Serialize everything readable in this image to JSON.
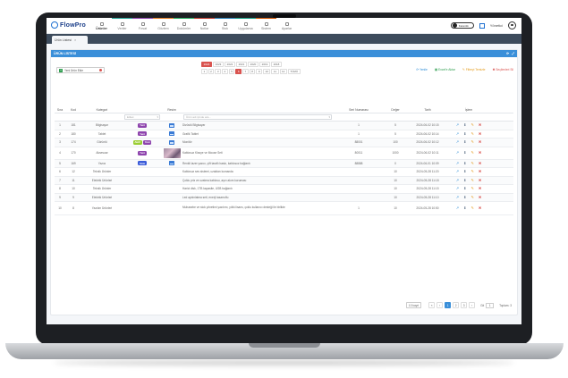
{
  "app": {
    "logo_text": "FlowPro"
  },
  "nav": [
    {
      "label": "Ürünler"
    },
    {
      "label": "Veriler"
    },
    {
      "label": "Fırsat"
    },
    {
      "label": "Gözlem"
    },
    {
      "label": "Dokümler"
    },
    {
      "label": "Notlar"
    },
    {
      "label": "Stok"
    },
    {
      "label": "Uygulama"
    },
    {
      "label": "Sistem"
    },
    {
      "label": "Ayarlar"
    }
  ],
  "topbar": {
    "toggle_label": "Karanlık",
    "username": "Yönetici"
  },
  "tab": {
    "label": "Ürün Listesi"
  },
  "card": {
    "title": "ÜRÜN LİSTESİ"
  },
  "toolbar": {
    "add_label": "Yeni Ürün Ekle",
    "years": [
      "2024",
      "2023",
      "2022",
      "2021",
      "2020",
      "2019",
      "2018"
    ],
    "active_year": "2024",
    "months": [
      "1",
      "2",
      "3",
      "4",
      "5",
      "6",
      "7",
      "8",
      "9",
      "10",
      "11",
      "12",
      "TÜMÜ"
    ],
    "active_month": "6",
    "actions": [
      {
        "label": "Yenile"
      },
      {
        "label": "Excel'e Aktar"
      },
      {
        "label": "Filtreyi Temizle"
      },
      {
        "label": "Seçilenleri Sil"
      }
    ]
  },
  "table": {
    "headers": {
      "sira": "Sıra",
      "kod": "Kod",
      "kategori": "Kategori",
      "etiket": "",
      "resim": "Resim",
      "ad": "",
      "seri": "Seri Numarası",
      "deger": "Değer",
      "tarih": "Tarih",
      "islem": "İşlem"
    },
    "filters": {
      "etiket": "Etiket",
      "ad": "Ürün adı içinde ara..."
    },
    "rows": [
      {
        "sira": "1",
        "kod": "181",
        "kategori": "Bilgisayar",
        "tags": [
          {
            "t": "Yeni",
            "c": "#8e44ad"
          }
        ],
        "img": "icon",
        "ad": "Dizüstü Bilgisayar",
        "seri": "1",
        "deger": "5",
        "tarih": "2024-06-02 10:15"
      },
      {
        "sira": "2",
        "kod": "180",
        "kategori": "Tablet",
        "tags": [
          {
            "t": "Yeni",
            "c": "#8e44ad"
          }
        ],
        "img": "icon",
        "ad": "Grafik Tablet",
        "seri": "1",
        "deger": "5",
        "tarih": "2024-06-02 10:14"
      },
      {
        "sira": "3",
        "kod": "174",
        "kategori": "Görüntü",
        "tags": [
          {
            "t": "Aktif",
            "c": "#9acd32"
          },
          {
            "t": "Yeni",
            "c": "#8e44ad"
          }
        ],
        "img": "icon",
        "ad": "Monitör",
        "seri": "88001",
        "deger": "100",
        "tarih": "2024-06-02 10:12"
      },
      {
        "sira": "4",
        "kod": "170",
        "kategori": "Aksesuar",
        "tags": [
          {
            "t": "Yeni",
            "c": "#8e44ad"
          }
        ],
        "img": "thumb",
        "ad": "Kablosuz Klavye ve Mouse Seti",
        "seri": "80011",
        "deger": "1000",
        "tarih": "2024-06-02 10:11"
      },
      {
        "sira": "5",
        "kod": "169",
        "kategori": "Yazıcı",
        "tags": [
          {
            "t": "Stok",
            "c": "#3a5bd9"
          }
        ],
        "img": "icon",
        "ad": "Renkli lazer yazıcı, çift taraflı baskı, kablosuz bağlantı",
        "seri": "88888",
        "deger": "0",
        "tarih": "2024-06-01 10:09"
      },
      {
        "sira": "6",
        "kod": "12",
        "kategori": "Teknik Ürünler",
        "tags": [],
        "img": "",
        "ad": "Kablosuz ses sistemi, uzaktan kumanda",
        "seri": "",
        "deger": "10",
        "tarih": "2024-05-28 11:20"
      },
      {
        "sira": "7",
        "kod": "11",
        "kategori": "Elektrik Ürünleri",
        "tags": [],
        "img": "",
        "ad": "Çoklu priz ve uzatma kablosu, aşırı akım koruması",
        "seri": "",
        "deger": "10",
        "tarih": "2024-05-28 11:18"
      },
      {
        "sira": "8",
        "kod": "10",
        "kategori": "Teknik Ürünler",
        "tags": [],
        "img": "",
        "ad": "Harici disk, 1TB kapasite, USB bağlantı",
        "seri": "",
        "deger": "10",
        "tarih": "2024-05-28 11:15"
      },
      {
        "sira": "9",
        "kod": "9",
        "kategori": "Elektrik Ürünleri",
        "tags": [],
        "img": "",
        "ad": "Led aydınlatma seti, enerji tasarruflu",
        "seri": "",
        "deger": "10",
        "tarih": "2024-05-28 11:10"
      },
      {
        "sira": "10",
        "kod": "8",
        "kategori": "Yazılım Ürünleri",
        "tags": [],
        "img": "",
        "ad": "Muhasebe ve stok yönetimi yazılımı, yıllık lisans, çoklu kullanıcı desteği ile birlikte",
        "seri": "1",
        "deger": "10",
        "tarih": "2024-05-28 10:50"
      }
    ]
  },
  "pagination": {
    "page_size": "10 kayıt",
    "pages": [
      "1",
      "2",
      "3"
    ],
    "active_page": "1",
    "goto_label": "Git",
    "goto_value": "1",
    "total_label": "Toplam: 3"
  }
}
